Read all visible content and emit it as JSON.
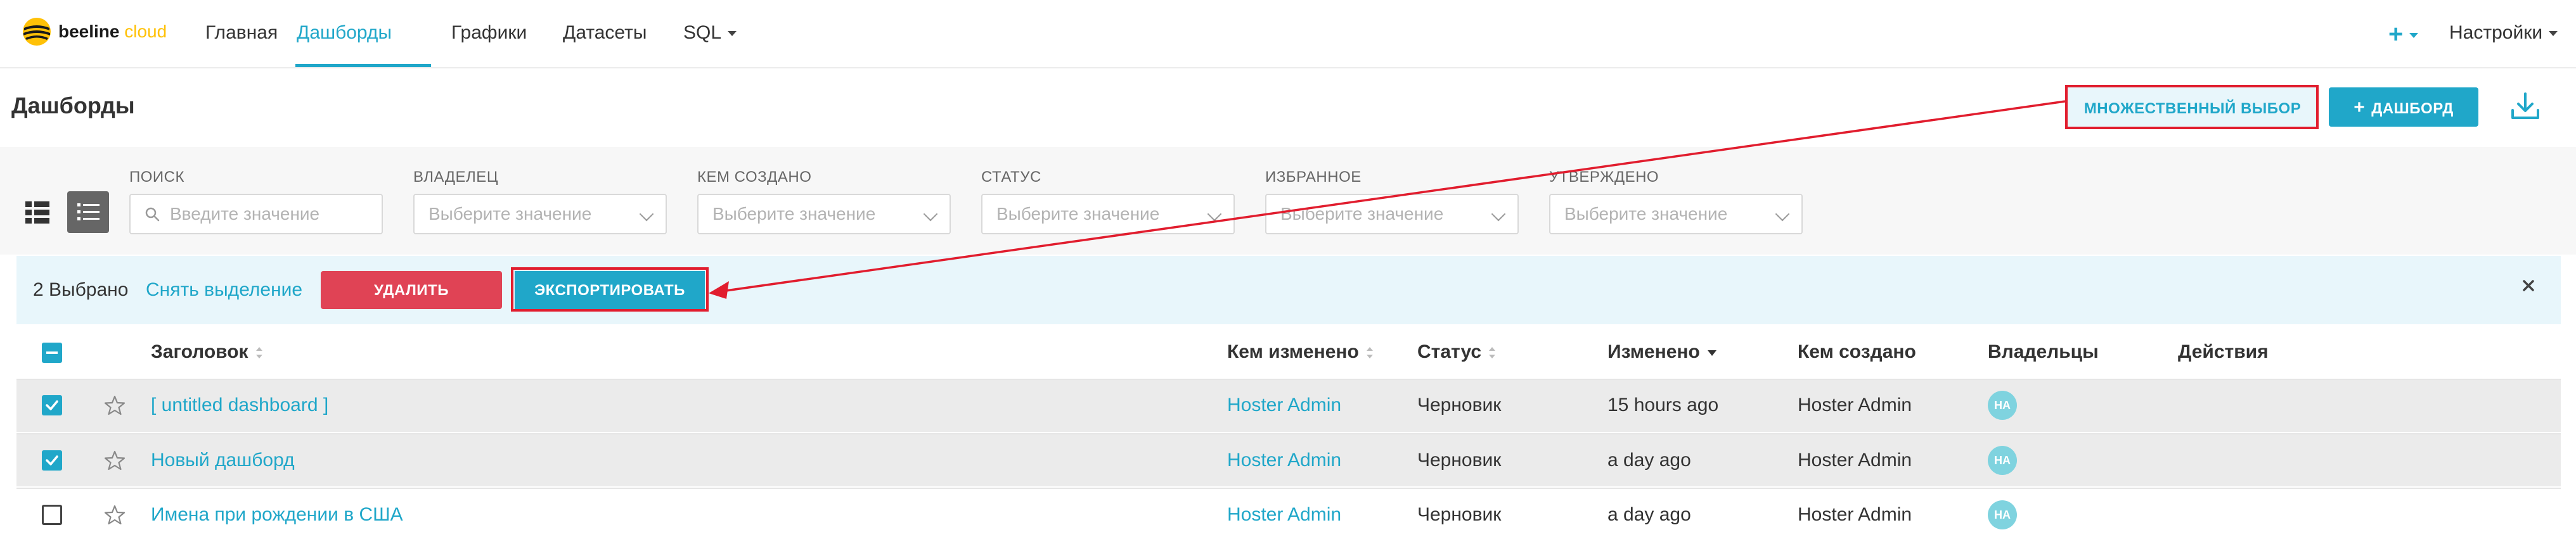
{
  "brand": {
    "name_part1": "beeline",
    "name_part2": "cloud",
    "accent": "#20a7c9",
    "logo_yellow": "#ffc107"
  },
  "nav": {
    "items": [
      {
        "label": "Главная"
      },
      {
        "label": "Дашборды",
        "active": true
      },
      {
        "label": "Графики"
      },
      {
        "label": "Датасеты"
      },
      {
        "label": "SQL",
        "dropdown": true
      }
    ],
    "plus_label": "+",
    "settings_label": "Настройки"
  },
  "page": {
    "title": "Дашборды",
    "multi_select_label": "МНОЖЕСТВЕННЫЙ ВЫБОР",
    "add_dashboard_label": "ДАШБОРД",
    "add_icon": "+"
  },
  "filters": {
    "search": {
      "label": "ПОИСК",
      "placeholder": "Введите значение"
    },
    "owner": {
      "label": "ВЛАДЕЛЕЦ",
      "placeholder": "Выберите значение"
    },
    "created_by": {
      "label": "КЕМ СОЗДАНО",
      "placeholder": "Выберите значение"
    },
    "status": {
      "label": "СТАТУС",
      "placeholder": "Выберите значение"
    },
    "favorite": {
      "label": "ИЗБРАННОЕ",
      "placeholder": "Выберите значение"
    },
    "approved": {
      "label": "УТВЕРЖДЕНО",
      "placeholder": "Выберите значение"
    }
  },
  "bulk": {
    "selected_text": "2 Выбрано",
    "clear_label": "Снять выделение",
    "delete_label": "УДАЛИТЬ",
    "export_label": "ЭКСПОРТИРОВАТЬ"
  },
  "table": {
    "headers": {
      "title": "Заголовок",
      "changed_by": "Кем изменено",
      "status": "Статус",
      "modified": "Изменено",
      "created_by": "Кем создано",
      "owners": "Владельцы",
      "actions": "Действия"
    },
    "rows": [
      {
        "title": "[ untitled dashboard ]",
        "changed_by": "Hoster Admin",
        "status": "Черновик",
        "modified": "15 hours ago",
        "created_by": "Hoster Admin",
        "owner_initials": "HA",
        "selected": true
      },
      {
        "title": "Новый дашборд",
        "changed_by": "Hoster Admin",
        "status": "Черновик",
        "modified": "a day ago",
        "created_by": "Hoster Admin",
        "owner_initials": "HA",
        "selected": true
      },
      {
        "title": "Имена при рождении в США",
        "changed_by": "Hoster Admin",
        "status": "Черновик",
        "modified": "a day ago",
        "created_by": "Hoster Admin",
        "owner_initials": "HA",
        "selected": false
      }
    ]
  },
  "icons": [
    "beeline-logo-icon",
    "download-icon",
    "grid-view-icon",
    "list-view-icon",
    "search-icon",
    "chevron-down-icon",
    "close-icon",
    "star-icon",
    "checkbox-icon"
  ],
  "annotation_color": "#e11d2e"
}
